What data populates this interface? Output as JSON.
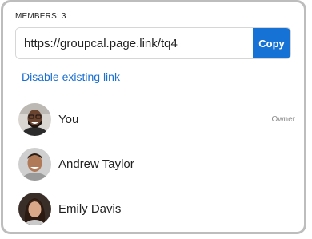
{
  "members_header": "MEMBERS: 3",
  "share_link": {
    "value": "https://groupcal.page.link/tq4",
    "copy_label": "Copy"
  },
  "disable_link_label": "Disable existing link",
  "members": [
    {
      "name": "You",
      "role": "Owner",
      "avatar": "avatar-photo"
    },
    {
      "name": "Andrew Taylor",
      "role": "",
      "avatar": "avatar-photo"
    },
    {
      "name": "Emily Davis",
      "role": "",
      "avatar": "avatar-photo"
    }
  ],
  "colors": {
    "accent": "#1672d4",
    "link": "#1a6fd1",
    "border": "#bdbdbd"
  }
}
